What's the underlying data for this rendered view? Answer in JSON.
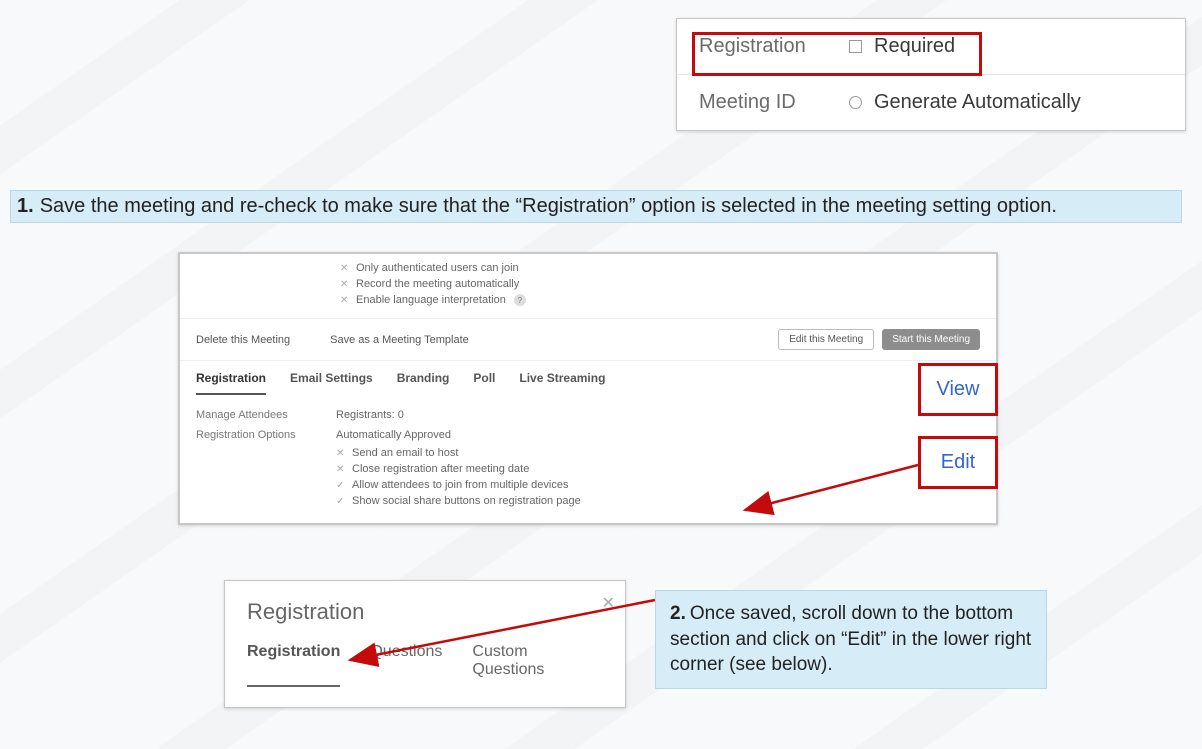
{
  "top_panel": {
    "registration_label": "Registration",
    "required_label": "Required",
    "meeting_id_label": "Meeting ID",
    "generate_label": "Generate Automatically"
  },
  "step1": {
    "num": "1.",
    "text": "Save the meeting and re-check to make sure that the “Registration” option is selected in the meeting setting option."
  },
  "meeting": {
    "options_top": [
      "Only authenticated users can join",
      "Record the meeting automatically",
      "Enable language interpretation"
    ],
    "delete_label": "Delete this Meeting",
    "save_template_label": "Save as a Meeting Template",
    "edit_btn": "Edit this Meeting",
    "start_btn": "Start this Meeting",
    "tabs": [
      "Registration",
      "Email Settings",
      "Branding",
      "Poll",
      "Live Streaming"
    ],
    "manage_attendees_label": "Manage Attendees",
    "registrants_value": "Registrants: 0",
    "reg_options_label": "Registration Options",
    "approval_value": "Automatically Approved",
    "option_flags": [
      {
        "mark": "x",
        "text": "Send an email to host"
      },
      {
        "mark": "x",
        "text": "Close registration after meeting date"
      },
      {
        "mark": "v",
        "text": "Allow attendees to join from multiple devices"
      },
      {
        "mark": "v",
        "text": "Show social share buttons on registration page"
      }
    ],
    "view_link": "View",
    "edit_link": "Edit"
  },
  "modal": {
    "title": "Registration",
    "tabs": [
      "Registration",
      "Questions",
      "Custom Questions"
    ]
  },
  "step2": {
    "num": "2.",
    "text": "Once saved, scroll down to the bottom section and click on “Edit” in the lower right corner (see below)."
  }
}
